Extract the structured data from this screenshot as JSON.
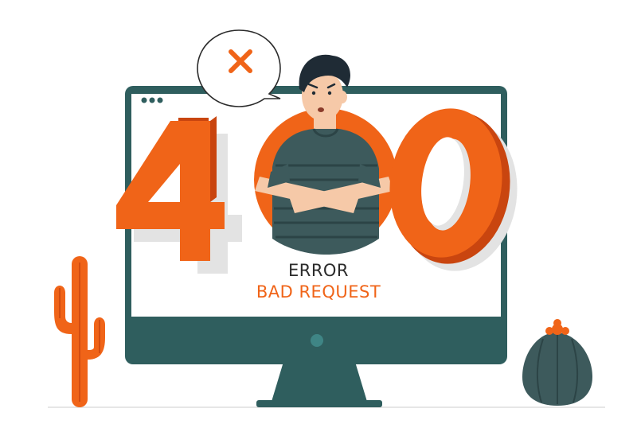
{
  "illustration": {
    "code_digits": [
      "4",
      "0",
      "0"
    ],
    "error_label": "ERROR",
    "error_message": "BAD REQUEST",
    "speech_bubble_icon": "close-icon",
    "window_dots_icon": "three-dots-icon"
  },
  "colors": {
    "accent": "#f06418",
    "accent_dark": "#c9450f",
    "screen_frame": "#2f5e5e",
    "screen_bg": "#ffffff",
    "shirt": "#3d5a5c",
    "skin": "#f6c9a8",
    "hair": "#1f2b35",
    "cactus": "#3d5a5c",
    "shadow": "#e3e3e3"
  }
}
